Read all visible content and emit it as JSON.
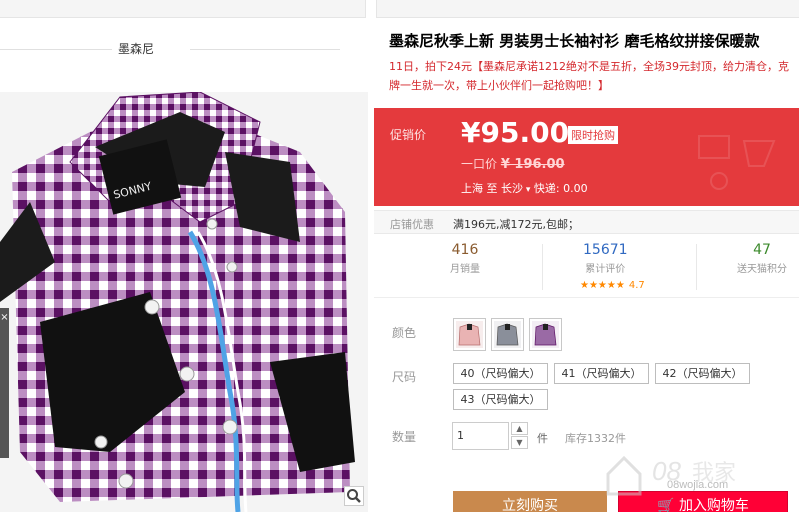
{
  "shop": {
    "name": "墨森尼"
  },
  "product": {
    "title": "墨森尼秋季上新 男装男士长袖衬衫 磨毛格纹拼接保暖款",
    "subtitle": "11日，拍下24元【墨森尼承诺1212绝对不是五折，全场39元封顶，给力清仓，克牌一生就一次，带上小伙伴们一起抢购吧！】"
  },
  "promo": {
    "label": "促销价",
    "price": "¥95.00",
    "badge": "限时抢购",
    "original_label": "一口价",
    "original_price": "¥ 196.00",
    "ship_from": "上海",
    "ship_to_label": "至",
    "ship_to": "长沙",
    "shipping_text": "快递: 0.00"
  },
  "shop_offer": {
    "label": "店铺优惠",
    "text": "满196元,减172元,包邮；"
  },
  "stats": {
    "monthly_sales": {
      "value": "416",
      "label": "月销量"
    },
    "reviews": {
      "value": "15671",
      "label": "累计评价",
      "stars": "★★★★★",
      "rating": "4.7"
    },
    "points": {
      "value": "47",
      "label": "送天猫积分"
    }
  },
  "options": {
    "color_label": "颜色",
    "size_label": "尺码",
    "sizes": [
      "40（尺码偏大）",
      "41（尺码偏大）",
      "42（尺码偏大）",
      "43（尺码偏大）"
    ],
    "colors": [
      {
        "name": "pink-plaid",
        "hex": "#e9b3b3"
      },
      {
        "name": "gray-plaid",
        "hex": "#8a8f9a"
      },
      {
        "name": "purple-plaid",
        "hex": "#9a6aa5"
      }
    ]
  },
  "quantity": {
    "label": "数量",
    "value": "1",
    "unit": "件",
    "stock": "库存1332件"
  },
  "actions": {
    "buy_now": "立刻购买",
    "add_to_cart": "加入购物车"
  },
  "watermark": {
    "text": "08wojia.com"
  },
  "theme": {
    "promo_red": "#e43a3d",
    "tmall_red": "#ff0036",
    "plaid_purple": "#6a1f6e"
  }
}
